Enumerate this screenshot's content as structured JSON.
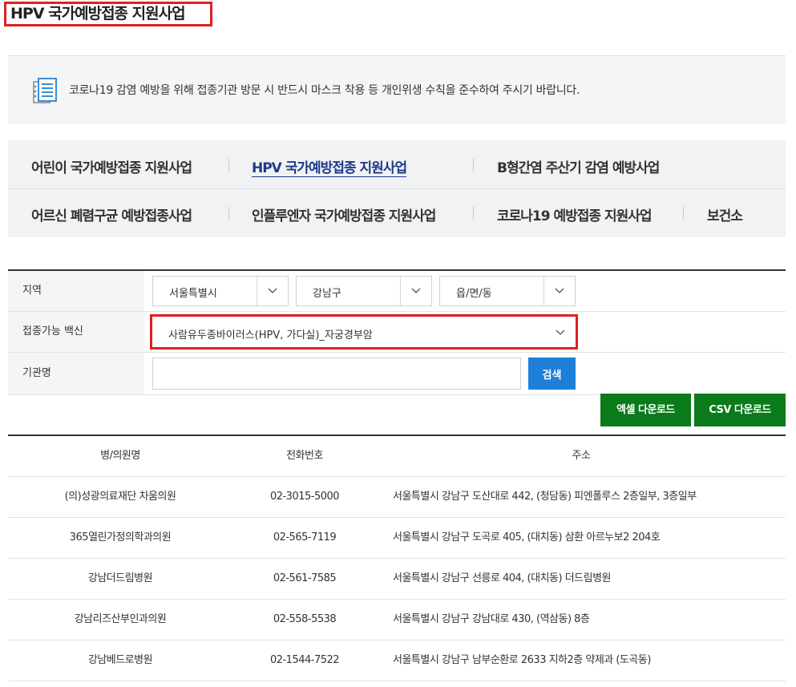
{
  "page_title": "HPV 국가예방접종 지원사업",
  "notice": {
    "icon": "document-list-icon",
    "text": "코로나19 감염 예방을 위해 접종기관 방문 시 반드시 마스크 착용 등 개인위생 수칙을 준수하여 주시기 바랍니다."
  },
  "tabs": {
    "row1": [
      "어린이 국가예방접종 지원사업",
      "HPV 국가예방접종 지원사업",
      "B형간염 주산기 감염 예방사업"
    ],
    "row2": [
      "어르신 폐렴구균 예방접종사업",
      "인플루엔자 국가예방접종 지원사업",
      "코로나19 예방접종 지원사업",
      "보건소"
    ],
    "active": "HPV 국가예방접종 지원사업"
  },
  "form": {
    "region_label": "지역",
    "city": "서울특별시",
    "district": "강남구",
    "town": "읍/면/동",
    "vaccine_label": "접종가능 백신",
    "vaccine": "사람유두종바이러스(HPV, 가다실)_자궁경부암",
    "institution_label": "기관명",
    "institution_value": "",
    "search_label": "검색"
  },
  "downloads": {
    "excel": "엑셀 다운로드",
    "csv": "CSV 다운로드"
  },
  "table": {
    "headers": [
      "병/의원명",
      "전화번호",
      "주소"
    ],
    "rows": [
      [
        "(의)성광의료재단 차움의원",
        "02-3015-5000",
        "서울특별시 강남구 도산대로 442, (청담동) 피엔폴루스 2층일부, 3층일부"
      ],
      [
        "365열린가정의학과의원",
        "02-565-7119",
        "서울특별시 강남구 도곡로 405, (대치동) 삼환 아르누보2 204호"
      ],
      [
        "강남더드림병원",
        "02-561-7585",
        "서울특별시 강남구 선릉로 404, (대치동) 더드림병원"
      ],
      [
        "강남리즈산부인과의원",
        "02-558-5538",
        "서울특별시 강남구 강남대로 430, (역삼동) 8층"
      ],
      [
        "강남베드로병원",
        "02-1544-7522",
        "서울특별시 강남구 남부순환로 2633 지하2층 약제과 (도곡동)"
      ]
    ]
  },
  "colors": {
    "highlight": "#e02020",
    "active_tab": "#1f3a8a",
    "search_button": "#1e7fd9",
    "download_button": "#0a7a1a"
  }
}
